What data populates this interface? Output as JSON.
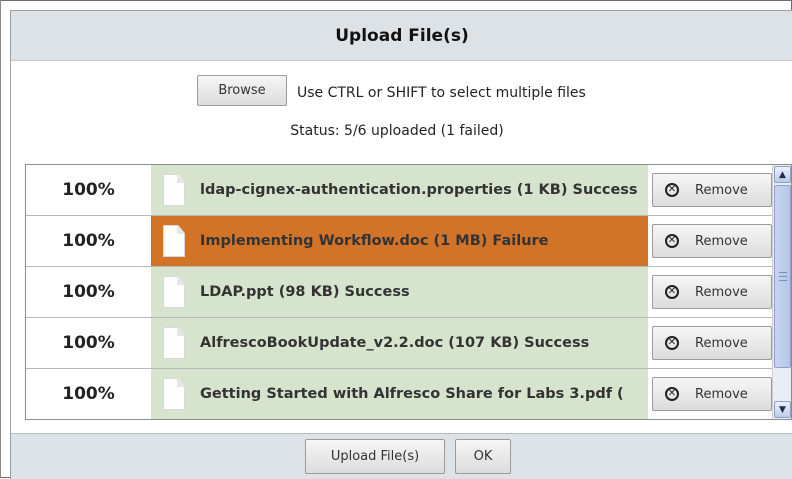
{
  "dialog": {
    "title": "Upload File(s)",
    "browse_label": "Browse",
    "hint": "Use CTRL or SHIFT to select multiple files",
    "status": "Status: 5/6 uploaded (1 failed)"
  },
  "files": [
    {
      "percent": "100%",
      "name": "ldap-cignex-authentication.properties (1 KB) Success",
      "state": "success",
      "remove_label": "Remove"
    },
    {
      "percent": "100%",
      "name": "Implementing Workflow.doc (1 MB) Failure",
      "state": "failure",
      "remove_label": "Remove"
    },
    {
      "percent": "100%",
      "name": "LDAP.ppt (98 KB) Success",
      "state": "success",
      "remove_label": "Remove"
    },
    {
      "percent": "100%",
      "name": "AlfrescoBookUpdate_v2.2.doc (107 KB) Success",
      "state": "success",
      "remove_label": "Remove"
    },
    {
      "percent": "100%",
      "name": "Getting Started with Alfresco Share for Labs 3.pdf (",
      "state": "success",
      "remove_label": "Remove"
    }
  ],
  "footer": {
    "upload_label": "Upload File(s)",
    "ok_label": "OK"
  },
  "colors": {
    "success_bg": "#d7e4cd",
    "failure_bg": "#d27428",
    "header_bg": "#dde2e6"
  },
  "icons": {
    "file": "document-icon",
    "remove": "remove-circle-x-icon",
    "scroll_up": "scroll-up-arrow-icon",
    "scroll_down": "scroll-down-arrow-icon"
  }
}
